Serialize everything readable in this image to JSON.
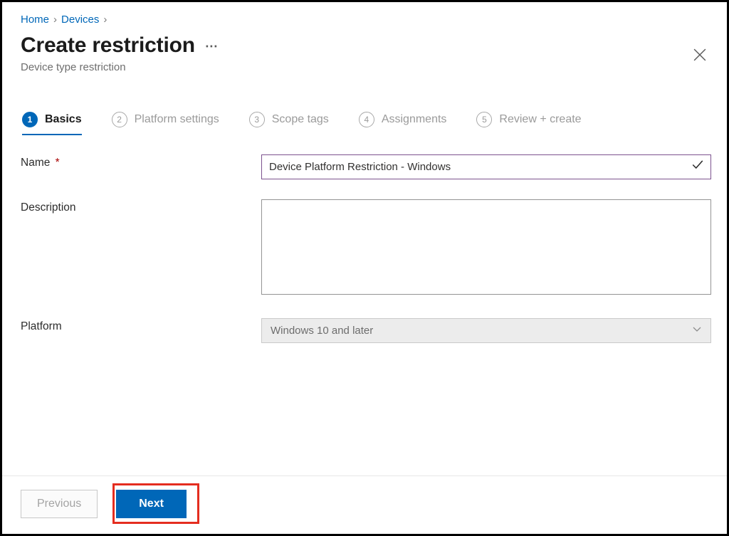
{
  "breadcrumb": {
    "items": [
      {
        "text": "Home"
      },
      {
        "text": "Devices"
      }
    ]
  },
  "header": {
    "title": "Create restriction",
    "subtitle": "Device type restriction"
  },
  "tabs": [
    {
      "num": "1",
      "label": "Basics"
    },
    {
      "num": "2",
      "label": "Platform settings"
    },
    {
      "num": "3",
      "label": "Scope tags"
    },
    {
      "num": "4",
      "label": "Assignments"
    },
    {
      "num": "5",
      "label": "Review + create"
    }
  ],
  "form": {
    "name_label": "Name",
    "name_value": "Device Platform Restriction - Windows",
    "description_label": "Description",
    "description_value": "",
    "platform_label": "Platform",
    "platform_value": "Windows 10 and later"
  },
  "footer": {
    "previous_label": "Previous",
    "next_label": "Next"
  }
}
